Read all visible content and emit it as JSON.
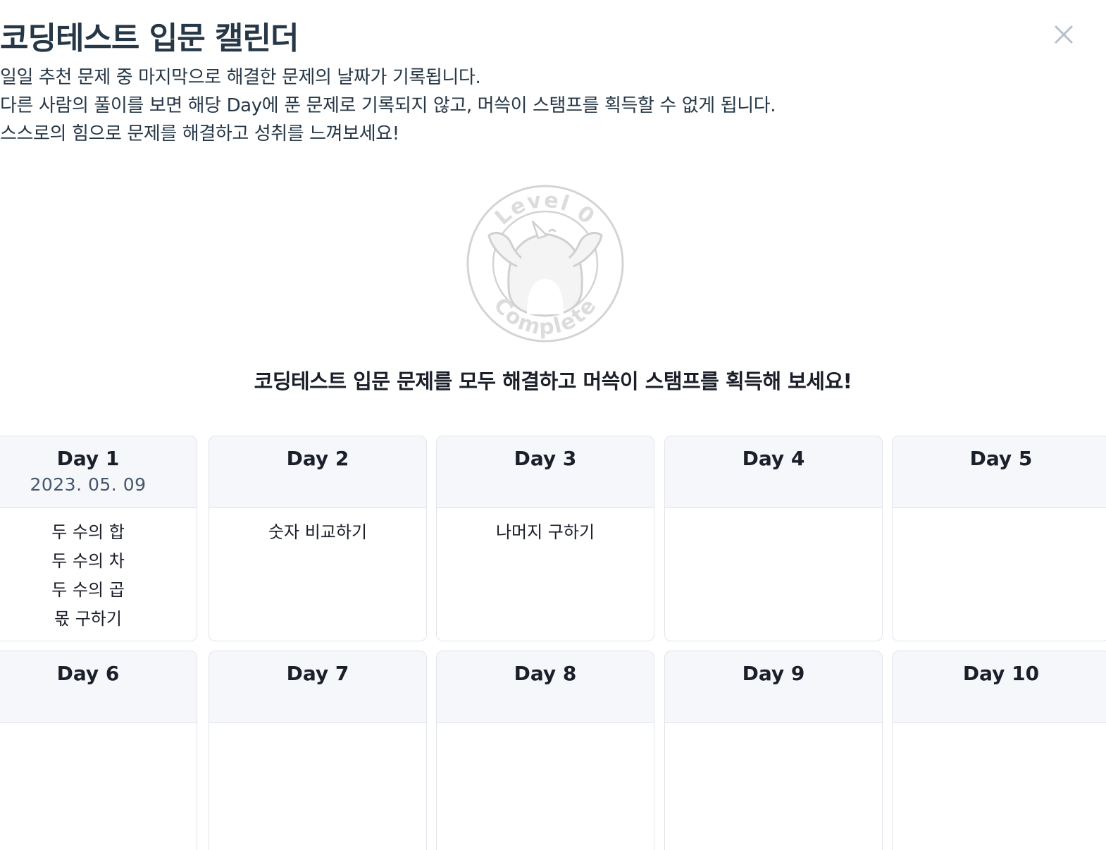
{
  "modal": {
    "title": "코딩테스트 입문 캘린더",
    "close_icon": "close-icon",
    "description": [
      "일일 추천 문제 중 마지막으로 해결한 문제의 날짜가 기록됩니다.",
      "다른 사람의 풀이를 보면 해당 Day에 푼 문제로 기록되지 않고, 머쓱이 스탬프를 획득할 수 없게 됩니다.",
      "스스로의 힘으로 문제를 해결하고 성취를 느껴보세요!"
    ],
    "stamp": {
      "icon": "level-0-complete-stamp",
      "top_text": "Level 0",
      "bottom_text": "Complete"
    },
    "cta": "코딩테스트 입문 문제를 모두 해결하고 머쓱이 스탬프를 획득해 보세요!"
  },
  "days": [
    {
      "label": "Day 1",
      "date": "2023. 05. 09",
      "problems": [
        "두 수의 합",
        "두 수의 차",
        "두 수의 곱",
        "몫 구하기"
      ]
    },
    {
      "label": "Day 2",
      "date": "",
      "problems": [
        "숫자 비교하기"
      ]
    },
    {
      "label": "Day 3",
      "date": "",
      "problems": [
        "나머지 구하기"
      ]
    },
    {
      "label": "Day 4",
      "date": "",
      "problems": []
    },
    {
      "label": "Day 5",
      "date": "",
      "problems": []
    },
    {
      "label": "Day 6",
      "date": "",
      "problems": []
    },
    {
      "label": "Day 7",
      "date": "",
      "problems": []
    },
    {
      "label": "Day 8",
      "date": "",
      "problems": []
    },
    {
      "label": "Day 9",
      "date": "",
      "problems": []
    },
    {
      "label": "Day 10",
      "date": "",
      "problems": []
    }
  ],
  "colors": {
    "text_primary": "#263747",
    "card_border": "#e1e4ec",
    "card_header_bg": "#f6f7fb",
    "stamp_stroke": "#d4d4d4"
  }
}
